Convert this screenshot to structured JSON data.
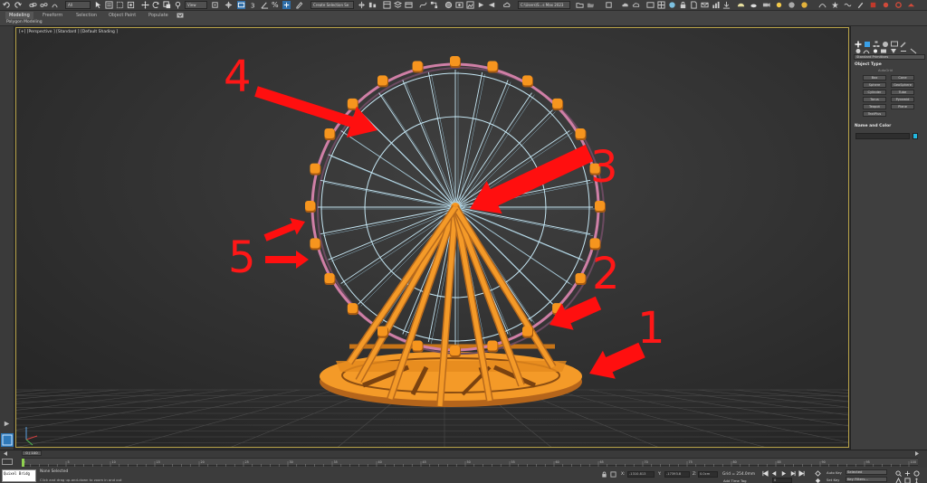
{
  "toolbar": {
    "undo_icon": "undo-icon",
    "selection_filter": "All",
    "view_dropdown": "View",
    "selection_set": "Create Selection Se",
    "workspace": "C:\\Users\\S...s Max 2023",
    "percent_symbol": "%"
  },
  "ribbon": {
    "tabs": [
      "Modeling",
      "Freeform",
      "Selection",
      "Object Paint",
      "Populate"
    ],
    "sub_label": "Polygon Modeling"
  },
  "viewport": {
    "label": "[+] [Perspective ] [Standard ] [Default Shading ]",
    "annotations": [
      "1",
      "2",
      "3",
      "4",
      "5"
    ],
    "colors": {
      "arrow": "#ff0f0f",
      "wheel_frame": "#cf7fa6",
      "spokes": "#c5e6f3",
      "cabins": "#f6951e",
      "base": "#f49a28"
    }
  },
  "command_panel": {
    "dropdown": "Standard Primitives",
    "object_type_header": "Object Type",
    "autogrid": "AutoGrid",
    "buttons": [
      "Box",
      "Cone",
      "Sphere",
      "GeoSphere",
      "Cylinder",
      "Tube",
      "Torus",
      "Pyramid",
      "Teapot",
      "Plane",
      "TextPlus"
    ],
    "name_color_header": "Name and Color",
    "swatch_color": "#22b8e0"
  },
  "timeline": {
    "slider": "0 / 100",
    "ticks": [
      "0",
      "5",
      "10",
      "15",
      "20",
      "25",
      "30",
      "35",
      "40",
      "45",
      "50",
      "55",
      "60",
      "65",
      "70",
      "75",
      "80",
      "85",
      "90",
      "95",
      "100"
    ]
  },
  "status": {
    "maxscript": "Quixel Bridg",
    "selected": "None Selected",
    "hint": "Click and drag up-and-down to zoom in and out",
    "x_label": "X:",
    "x_value": "-1310.813",
    "y_label": "Y:",
    "y_value": "-17393.8",
    "z_label": "Z:",
    "z_value": "0.0cm",
    "grid": "Grid = 254.0mm",
    "add_time_tag": "Add Time Tag",
    "auto_key": "Auto Key",
    "set_key": "Set Key",
    "selected_dd": "Selected",
    "key_filters": "Key Filters...",
    "frame": "0"
  }
}
